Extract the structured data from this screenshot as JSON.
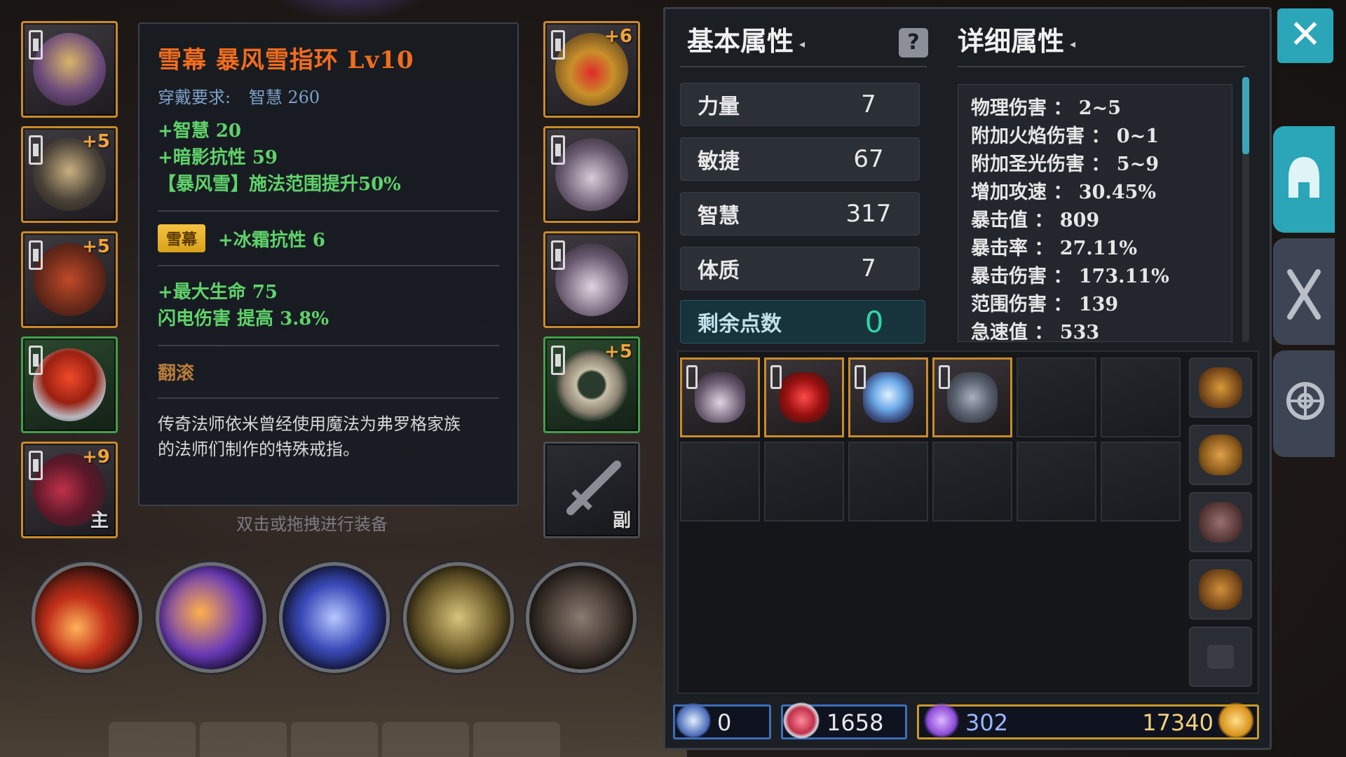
{
  "tooltip": {
    "title": "雪幕 暴风雪指环 Lv10",
    "requirement_label": "穿戴要求:",
    "requirement_value": "智慧 260",
    "stats_primary": [
      "+智慧 20",
      "+暗影抗性 59",
      "【暴风雪】施法范围提升50%"
    ],
    "set_badge": "雪幕",
    "set_stat": "+冰霜抗性 6",
    "stats_secondary": [
      "+最大生命 75",
      "闪电伤害 提高 3.8%"
    ],
    "skill": "翻滚",
    "description_lines": [
      "传奇法师依米曾经使用魔法为弗罗格家族",
      "的法师们制作的特殊戒指。"
    ]
  },
  "hint": "双击或拖拽进行装备",
  "equipment": {
    "left": [
      {
        "name": "helmet",
        "plus": ""
      },
      {
        "name": "shoulder",
        "plus": "+5"
      },
      {
        "name": "chest",
        "plus": "+5"
      },
      {
        "name": "ring",
        "plus": ""
      },
      {
        "name": "main-weapon",
        "plus": "+9",
        "sub": "主"
      }
    ],
    "right": [
      {
        "name": "necklace",
        "plus": "+6"
      },
      {
        "name": "gloves",
        "plus": ""
      },
      {
        "name": "boots",
        "plus": ""
      },
      {
        "name": "ring-2",
        "plus": "+5"
      },
      {
        "name": "offhand",
        "plus": "",
        "sub": "副"
      }
    ]
  },
  "panel": {
    "basic_title": "基本属性",
    "detail_title": "详细属性",
    "help_icon": "?",
    "attributes": [
      {
        "label": "力量",
        "value": "7"
      },
      {
        "label": "敏捷",
        "value": "67"
      },
      {
        "label": "智慧",
        "value": "317"
      },
      {
        "label": "体质",
        "value": "7"
      }
    ],
    "remaining_label": "剩余点数",
    "remaining_value": "0",
    "details": [
      "物理伤害 ： 2~5",
      "附加火焰伤害 ： 0~1",
      "附加圣光伤害 ： 5~9",
      "增加攻速 ： 30.45%",
      "暴击值 ： 809",
      "暴击率 ： 27.11%",
      "暴击伤害 ： 173.11%",
      "范围伤害 ： 139",
      "急速值 ： 533"
    ]
  },
  "currency": {
    "wand": "0",
    "crystal_heart": "1658",
    "gem": "302",
    "gold": "17340"
  },
  "colors": {
    "legendary_orange": "#f26c1e",
    "stat_green": "#5fd26a",
    "accent_teal": "#2aa6b8",
    "slot_gold": "#c98a2a"
  }
}
